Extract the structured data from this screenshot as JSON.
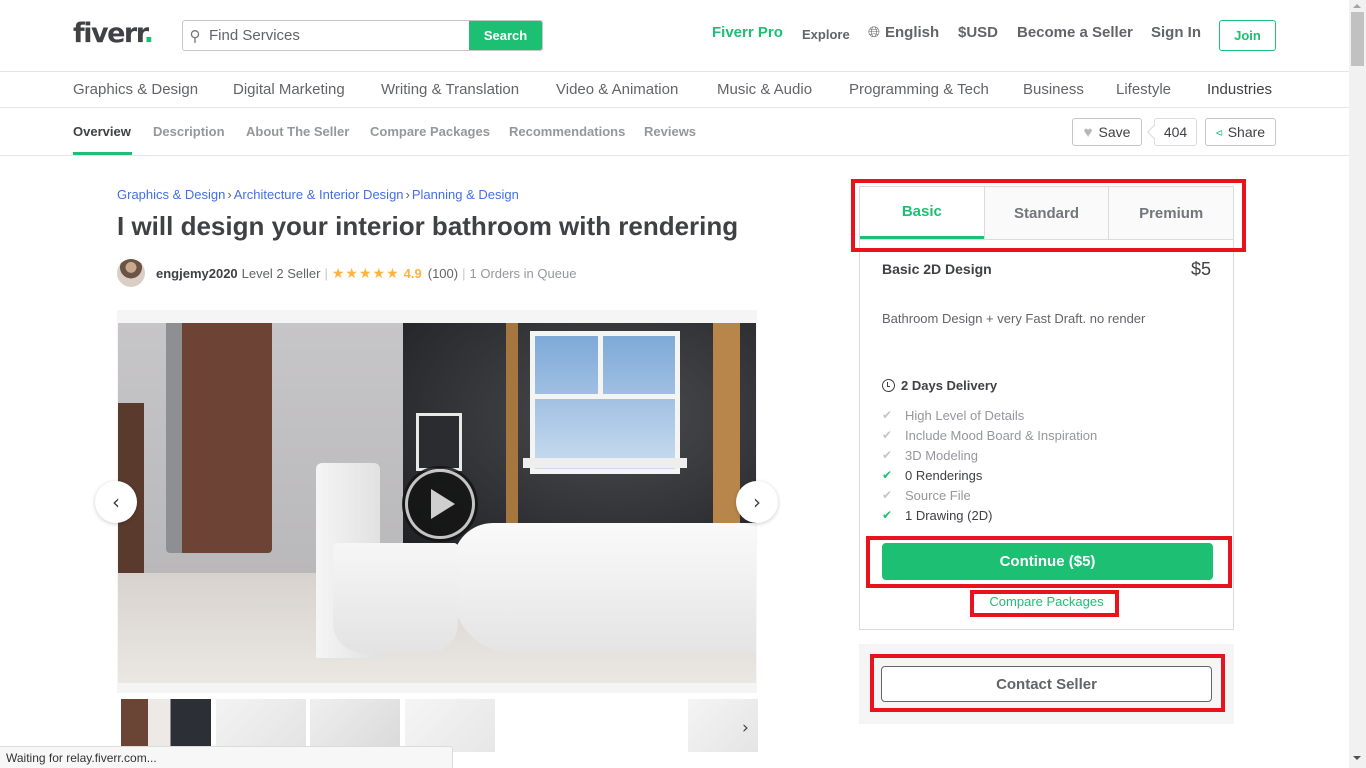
{
  "header": {
    "logo_text": "fiverr",
    "logo_dot": ".",
    "search": {
      "placeholder": "Find Services",
      "value": "",
      "button_label": "Search"
    },
    "nav": {
      "pro": "Fiverr Pro",
      "explore": "Explore",
      "language": "English",
      "currency": "$USD",
      "become_seller": "Become a Seller",
      "sign_in": "Sign In",
      "join": "Join"
    }
  },
  "categories": [
    "Graphics & Design",
    "Digital Marketing",
    "Writing & Translation",
    "Video & Animation",
    "Music & Audio",
    "Programming & Tech",
    "Business",
    "Lifestyle",
    "Industries"
  ],
  "subnav": {
    "tabs": [
      "Overview",
      "Description",
      "About The Seller",
      "Compare Packages",
      "Recommendations",
      "Reviews"
    ],
    "active_tab": "Overview",
    "save_label": "Save",
    "save_count": "404",
    "share_label": "Share"
  },
  "gig": {
    "breadcrumb": [
      "Graphics & Design",
      "Architecture & Interior Design",
      "Planning & Design"
    ],
    "breadcrumb_separator": "›",
    "title": "I will design your interior bathroom with rendering",
    "seller": {
      "username": "engjemy2020",
      "level": "Level 2 Seller",
      "stars": 5,
      "rating": "4.9",
      "review_count": "(100)",
      "queue": "1 Orders in Queue"
    },
    "gallery": {
      "thumbnail_count": 5,
      "has_video": true
    }
  },
  "package": {
    "tabs": [
      "Basic",
      "Standard",
      "Premium"
    ],
    "active_tab": "Basic",
    "name": "Basic 2D Design",
    "price": "$5",
    "description": "Bathroom Design + very Fast Draft. no render",
    "delivery": "2 Days Delivery",
    "features": [
      {
        "label": "High Level of Details",
        "included": false
      },
      {
        "label": "Include Mood Board & Inspiration",
        "included": false
      },
      {
        "label": "3D Modeling",
        "included": false
      },
      {
        "label": "0 Renderings",
        "included": true
      },
      {
        "label": "Source File",
        "included": false
      },
      {
        "label": "1 Drawing (2D)",
        "included": true
      }
    ],
    "continue_label": "Continue ($5)",
    "compare_label": "Compare Packages",
    "contact_label": "Contact Seller"
  },
  "status_bar": "Waiting for relay.fiverr.com...",
  "colors": {
    "brand_green": "#1dbf73",
    "link_blue": "#446ee7",
    "star": "#ffb33e",
    "highlight_red": "#e8131f"
  }
}
